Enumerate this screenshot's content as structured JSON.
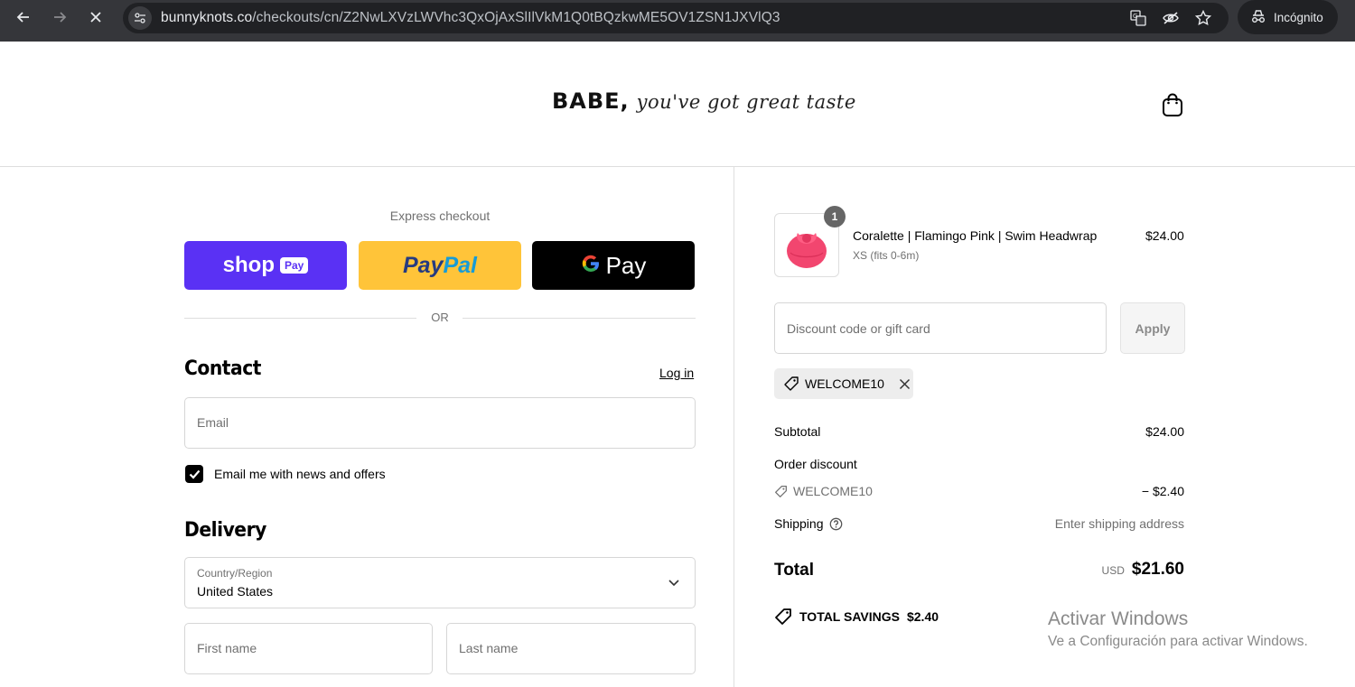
{
  "browser": {
    "url_host": "bunnyknots.co",
    "url_path": "/checkouts/cn/Z2NwLXVzLWVhc3QxOjAxSlIlVkM1Q0tBQzkwME5OV1ZSN1JXVlQ3",
    "incognito_label": "Incógnito"
  },
  "header": {
    "logo_main": "BABE,",
    "logo_script": "you've got great taste"
  },
  "checkout": {
    "express_label": "Express checkout",
    "shop_pay_label": "shop",
    "shop_pay_badge": "Pay",
    "paypal_label_1": "Pay",
    "paypal_label_2": "Pal",
    "gpay_g": "G",
    "gpay_label": "Pay",
    "or_label": "OR",
    "contact_title": "Contact",
    "login_label": "Log in",
    "email_placeholder": "Email",
    "newsletter_label": "Email me with news and offers",
    "newsletter_checked": true,
    "delivery_title": "Delivery",
    "country_label": "Country/Region",
    "country_value": "United States",
    "first_name_placeholder": "First name",
    "last_name_placeholder": "Last name"
  },
  "summary": {
    "item": {
      "quantity": "1",
      "name": "Coralette | Flamingo Pink | Swim Headwrap",
      "variant": "XS (fits 0-6m)",
      "price": "$24.00"
    },
    "discount_placeholder": "Discount code or gift card",
    "apply_label": "Apply",
    "applied_code": "WELCOME10",
    "subtotal_label": "Subtotal",
    "subtotal_value": "$24.00",
    "order_discount_label": "Order discount",
    "discount_code": "WELCOME10",
    "discount_value": "− $2.40",
    "shipping_label": "Shipping",
    "shipping_value": "Enter shipping address",
    "total_label": "Total",
    "currency": "USD",
    "total_value": "$21.60",
    "savings_label": "TOTAL SAVINGS",
    "savings_value": "$2.40"
  },
  "watermark": {
    "line1": "Activar Windows",
    "line2": "Ve a Configuración para activar Windows."
  },
  "colors": {
    "shop_pay": "#5a31f4",
    "paypal": "#ffc439",
    "gpay": "#000000",
    "product_pink": "#f2466f"
  }
}
